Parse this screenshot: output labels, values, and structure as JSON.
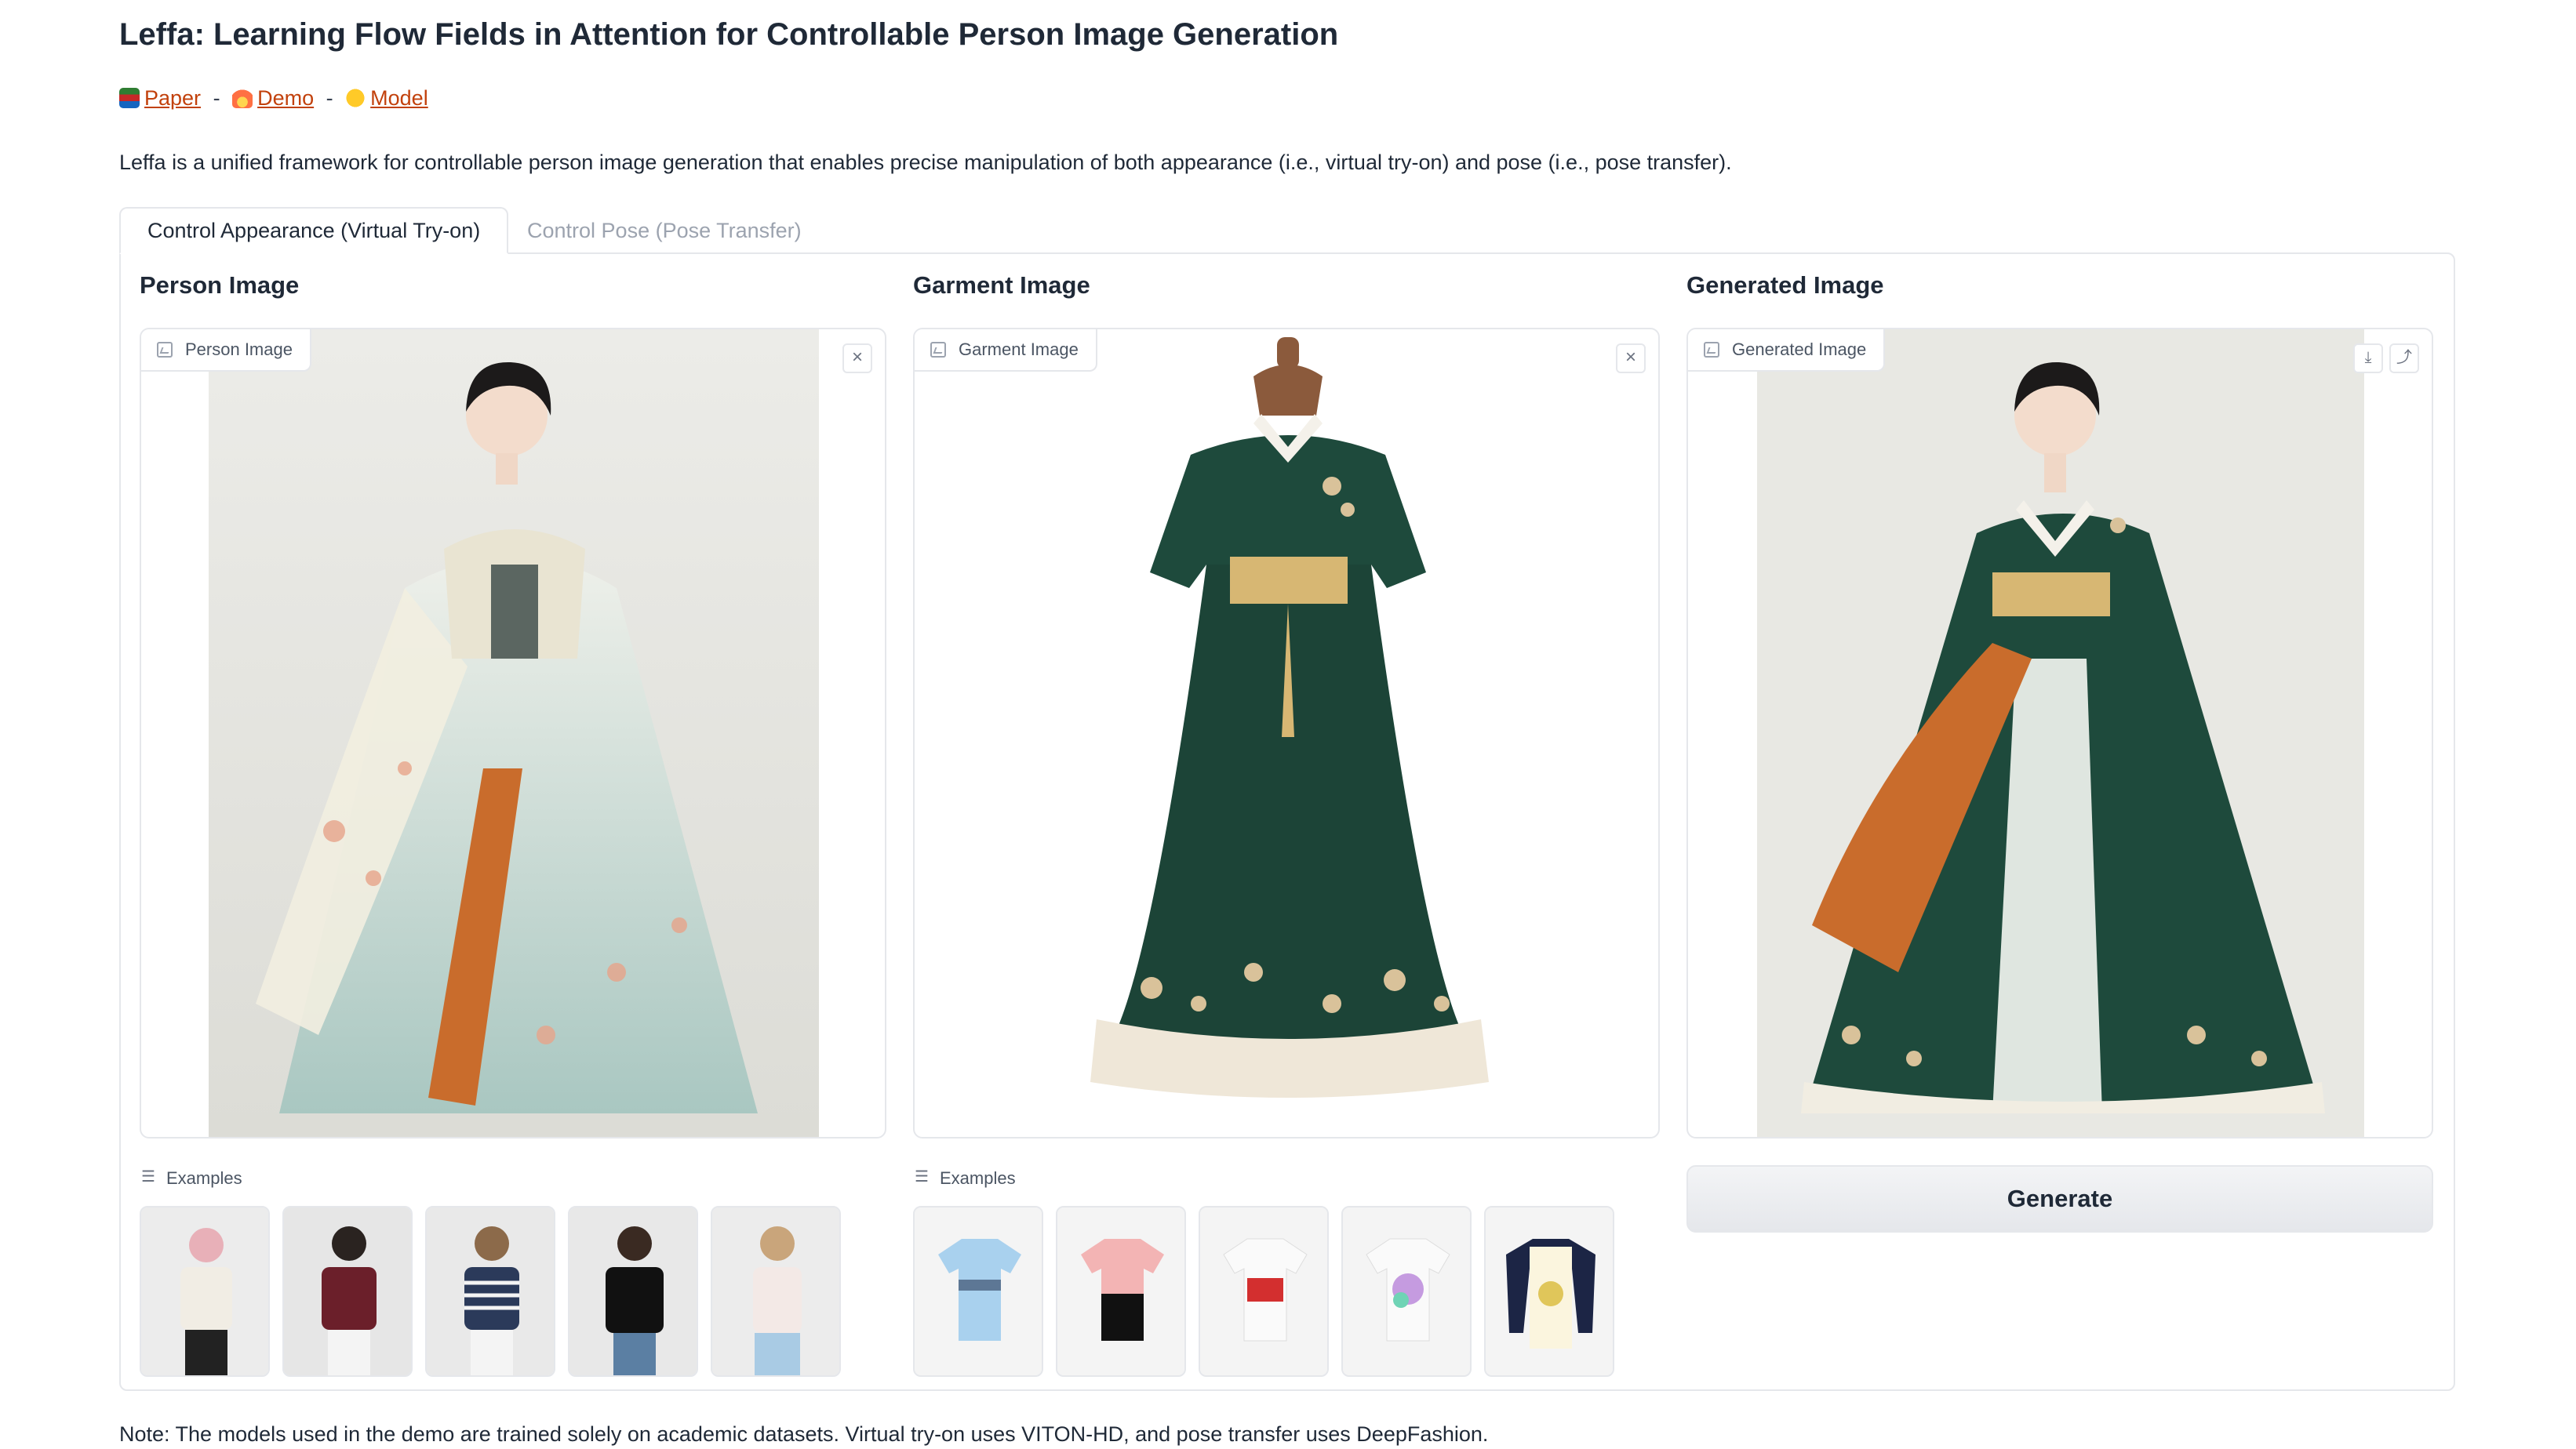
{
  "page": {
    "title": "Leffa: Learning Flow Fields in Attention for Controllable Person Image Generation",
    "links": [
      {
        "label": "Paper",
        "icon": "books-emoji"
      },
      {
        "label": "Demo",
        "icon": "fire-emoji"
      },
      {
        "label": "Model",
        "icon": "hugging-face-emoji"
      }
    ],
    "link_separator": "-",
    "description": "Leffa is a unified framework for controllable person image generation that enables precise manipulation of both appearance (i.e., virtual try-on) and pose (i.e., pose transfer).",
    "note": "Note: The models used in the demo are trained solely on academic datasets. Virtual try-on uses VITON-HD, and pose transfer uses DeepFashion."
  },
  "tabs": [
    {
      "label": "Control Appearance (Virtual Try-on)",
      "selected": true
    },
    {
      "label": "Control Pose (Pose Transfer)",
      "selected": false
    }
  ],
  "columns": {
    "person": {
      "title": "Person Image",
      "image_label": "Person Image",
      "clear_icon": "close-icon"
    },
    "garment": {
      "title": "Garment Image",
      "image_label": "Garment Image",
      "clear_icon": "close-icon"
    },
    "generated": {
      "title": "Generated Image",
      "image_label": "Generated Image",
      "actions": [
        "download-icon",
        "share-icon"
      ]
    }
  },
  "examples": {
    "label": "Examples",
    "person_count": 5,
    "garment_count": 5
  },
  "generate_button": {
    "label": "Generate"
  },
  "colors": {
    "link": "#c2410c",
    "border": "#e5e7eb",
    "muted_text": "#9ca3af",
    "garment_green": "#1e4a3c",
    "sash_gold": "#d7b773"
  }
}
